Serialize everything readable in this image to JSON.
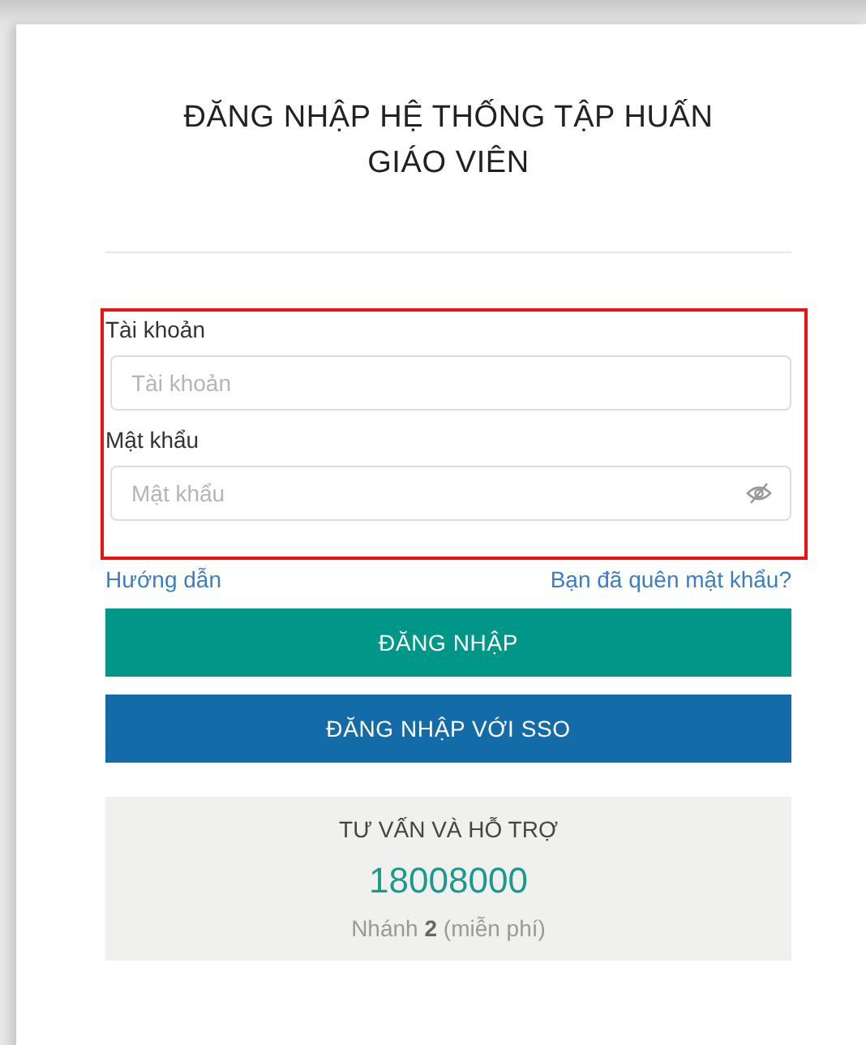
{
  "title_lines": [
    "ĐĂNG NHẬP HỆ THỐNG TẬP HUẤN",
    "GIÁO VIÊN"
  ],
  "fields": [
    {
      "label": "Tài khoản",
      "placeholder": "Tài khoản",
      "kind": "text"
    },
    {
      "label": "Mật khẩu",
      "placeholder": "Mật khẩu",
      "kind": "password"
    }
  ],
  "links": {
    "guide": "Hướng dẫn",
    "forgot": "Bạn đã quên mật khẩu?"
  },
  "buttons": [
    {
      "label": "ĐĂNG NHẬP",
      "kind": "primary"
    },
    {
      "label": "ĐĂNG NHẬP VỚI SSO",
      "kind": "sso"
    }
  ],
  "support": {
    "title": "TƯ VẤN VÀ HỖ TRỢ",
    "phone": "18008000",
    "note": "Nhánh **2** (miễn phí)"
  }
}
